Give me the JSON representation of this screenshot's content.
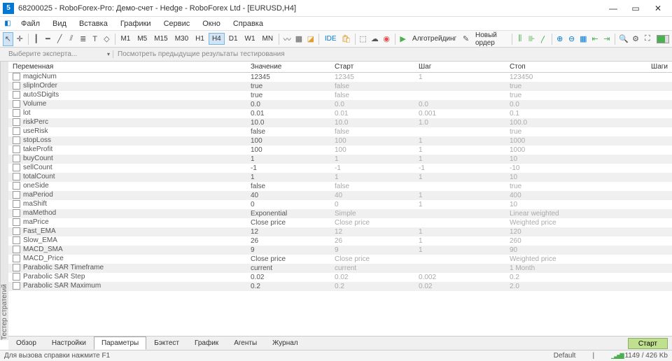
{
  "titlebar": {
    "title": "68200025 - RoboForex-Pro: Демо-счет - Hedge - RoboForex Ltd - [EURUSD,H4]"
  },
  "menubar": {
    "items": [
      "Файл",
      "Вид",
      "Вставка",
      "Графики",
      "Сервис",
      "Окно",
      "Справка"
    ]
  },
  "toolbar": {
    "timeframes": [
      "M1",
      "M5",
      "M15",
      "M30",
      "H1",
      "H4",
      "D1",
      "W1",
      "MN"
    ],
    "active_tf": "H4",
    "ide_label": "IDE",
    "algo_label": "Алготрейдинг",
    "new_order": "Новый ордер"
  },
  "expert_row": {
    "placeholder": "Выберите эксперта...",
    "hint": "Посмотреть предыдущие результаты тестирования"
  },
  "vtab": "Тестер стратегий",
  "columns": [
    "Переменная",
    "Значение",
    "Старт",
    "Шаг",
    "Стоп",
    "Шаги"
  ],
  "rows": [
    {
      "name": "magicNum",
      "value": "12345",
      "start": "12345",
      "step": "1",
      "stop": "123450"
    },
    {
      "name": "slipInOrder",
      "value": "true",
      "start": "false",
      "step": "",
      "stop": "true"
    },
    {
      "name": "autoSDigits",
      "value": "true",
      "start": "false",
      "step": "",
      "stop": "true"
    },
    {
      "name": "Volume",
      "value": "0.0",
      "start": "0.0",
      "step": "0.0",
      "stop": "0.0"
    },
    {
      "name": "lot",
      "value": "0.01",
      "start": "0.01",
      "step": "0.001",
      "stop": "0.1"
    },
    {
      "name": "riskPerc",
      "value": "10.0",
      "start": "10.0",
      "step": "1.0",
      "stop": "100.0"
    },
    {
      "name": "useRisk",
      "value": "false",
      "start": "false",
      "step": "",
      "stop": "true"
    },
    {
      "name": "stopLoss",
      "value": "100",
      "start": "100",
      "step": "1",
      "stop": "1000"
    },
    {
      "name": "takeProfit",
      "value": "100",
      "start": "100",
      "step": "1",
      "stop": "1000"
    },
    {
      "name": "buyCount",
      "value": "1",
      "start": "1",
      "step": "1",
      "stop": "10"
    },
    {
      "name": "sellCount",
      "value": "-1",
      "start": "-1",
      "step": "-1",
      "stop": "-10"
    },
    {
      "name": "totalCount",
      "value": "1",
      "start": "1",
      "step": "1",
      "stop": "10"
    },
    {
      "name": "oneSide",
      "value": "false",
      "start": "false",
      "step": "",
      "stop": "true"
    },
    {
      "name": "maPeriod",
      "value": "40",
      "start": "40",
      "step": "1",
      "stop": "400"
    },
    {
      "name": "maShift",
      "value": "0",
      "start": "0",
      "step": "1",
      "stop": "10"
    },
    {
      "name": "maMethod",
      "value": "Exponential",
      "start": "Simple",
      "step": "",
      "stop": "Linear weighted"
    },
    {
      "name": "maPrice",
      "value": "Close price",
      "start": "Close price",
      "step": "",
      "stop": "Weighted price"
    },
    {
      "name": "Fast_EMA",
      "value": "12",
      "start": "12",
      "step": "1",
      "stop": "120"
    },
    {
      "name": "Slow_EMA",
      "value": "26",
      "start": "26",
      "step": "1",
      "stop": "260"
    },
    {
      "name": "MACD_SMA",
      "value": "9",
      "start": "9",
      "step": "1",
      "stop": "90"
    },
    {
      "name": "MACD_Price",
      "value": "Close price",
      "start": "Close price",
      "step": "",
      "stop": "Weighted price"
    },
    {
      "name": "Parabolic SAR Timeframe",
      "value": "current",
      "start": "current",
      "step": "",
      "stop": "1 Month"
    },
    {
      "name": "Parabolic SAR Step",
      "value": "0.02",
      "start": "0.02",
      "step": "0.002",
      "stop": "0.2"
    },
    {
      "name": "Parabolic SAR Maximum",
      "value": "0.2",
      "start": "0.2",
      "step": "0.02",
      "stop": "2.0"
    }
  ],
  "bottom_tabs": {
    "items": [
      "Обзор",
      "Настройки",
      "Параметры",
      "Бэктест",
      "График",
      "Агенты",
      "Журнал"
    ],
    "active": "Параметры",
    "start_label": "Старт"
  },
  "statusbar": {
    "help": "Для вызова справки нажмите F1",
    "profile": "Default",
    "stats": "1149 / 426 Kb"
  }
}
